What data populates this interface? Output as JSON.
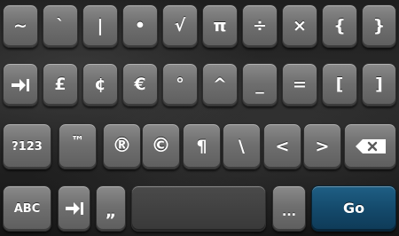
{
  "keyboard": {
    "row1": [
      "~",
      "`",
      "|",
      "•",
      "√",
      "π",
      "÷",
      "×",
      "{",
      "}"
    ],
    "row2": [
      "£",
      "¢",
      "€",
      "°",
      "^",
      "_",
      "=",
      "[",
      "]"
    ],
    "row3": [
      "™",
      "®",
      "©",
      "¶",
      "\\",
      "<",
      ">"
    ],
    "mode_key": "?123",
    "abc_key": "ABC",
    "quote_key": "„",
    "more_key": "...",
    "go_key": "Go",
    "space_key": "",
    "icons": {
      "tab": "tab-arrow-icon",
      "backspace": "backspace-icon"
    },
    "colors": {
      "key_face": "#6f6f6f",
      "go_key": "#144a6c",
      "background": "#1e1e1e"
    }
  }
}
